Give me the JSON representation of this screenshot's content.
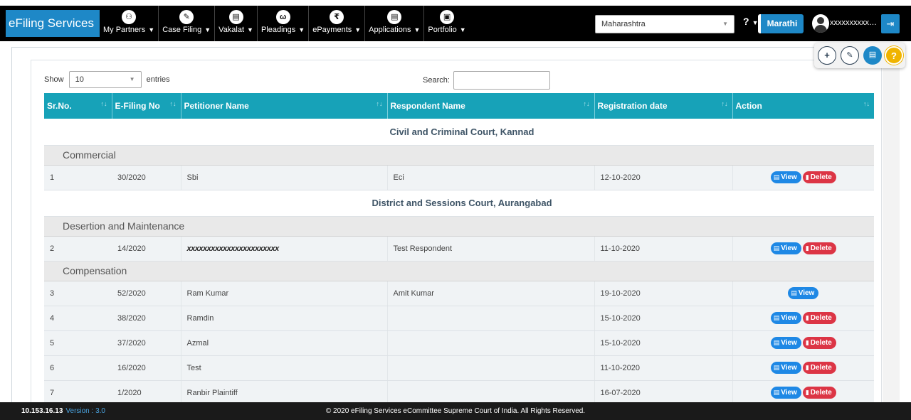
{
  "brand": "eFiling Services",
  "menu": [
    {
      "label": "My Partners",
      "icon": "partners-icon",
      "glyph": "⚇"
    },
    {
      "label": "Case Filing",
      "icon": "pencil-icon",
      "glyph": "✎"
    },
    {
      "label": "Vakalat",
      "icon": "document-icon",
      "glyph": "▤"
    },
    {
      "label": "Pleadings",
      "icon": "handshake-icon",
      "glyph": "ω"
    },
    {
      "label": "ePayments",
      "icon": "rupee-icon",
      "glyph": "₹"
    },
    {
      "label": "Applications",
      "icon": "file-icon",
      "glyph": "▤"
    },
    {
      "label": "Portfolio",
      "icon": "briefcase-icon",
      "glyph": "▣"
    }
  ],
  "header": {
    "state": "Maharashtra",
    "help": "?",
    "language": "Marathi",
    "username": "xxxxxxxxxxxxx..."
  },
  "table_controls": {
    "show_label": "Show",
    "entries_value": "10",
    "entries_label": "entries",
    "search_label": "Search:"
  },
  "columns": [
    "Sr.No.",
    "E-Filing No",
    "Petitioner Name",
    "Respondent Name",
    "Registration date",
    "Action"
  ],
  "groups": [
    {
      "court": "Civil and Criminal Court, Kannad",
      "categories": [
        {
          "name": "Commercial",
          "rows": [
            {
              "sr": "1",
              "efiling": "30/2020",
              "petitioner": "Sbi",
              "respondent": "Eci",
              "date": "12-10-2020",
              "delete": true
            }
          ]
        }
      ]
    },
    {
      "court": "District and Sessions Court, Aurangabad",
      "categories": [
        {
          "name": "Desertion and Maintenance",
          "rows": [
            {
              "sr": "2",
              "efiling": "14/2020",
              "petitioner": "xxxxxxxxxxxxxxxxxxxxxxx",
              "respondent": "Test Respondent",
              "date": "11-10-2020",
              "delete": true,
              "redacted": true
            }
          ]
        },
        {
          "name": "Compensation",
          "rows": [
            {
              "sr": "3",
              "efiling": "52/2020",
              "petitioner": "Ram Kumar",
              "respondent": "Amit Kumar",
              "date": "19-10-2020",
              "delete": false
            },
            {
              "sr": "4",
              "efiling": "38/2020",
              "petitioner": "Ramdin",
              "respondent": "",
              "date": "15-10-2020",
              "delete": true
            },
            {
              "sr": "5",
              "efiling": "37/2020",
              "petitioner": "Azmal",
              "respondent": "",
              "date": "15-10-2020",
              "delete": true
            },
            {
              "sr": "6",
              "efiling": "16/2020",
              "petitioner": "Test",
              "respondent": "",
              "date": "11-10-2020",
              "delete": true
            },
            {
              "sr": "7",
              "efiling": "1/2020",
              "petitioner": "Ranbir Plaintiff",
              "respondent": "",
              "date": "16-07-2020",
              "delete": true
            }
          ]
        }
      ]
    }
  ],
  "actions": {
    "view": "View",
    "delete": "Delete"
  },
  "footer": {
    "ip": "10.153.16.13",
    "version": "Version : 3.0",
    "copyright": "© 2020 eFiling Services eCommittee Supreme Court of India. All Rights Reserved."
  },
  "colors": {
    "brand": "#1e88c7",
    "table_header": "#17a2b8",
    "view": "#1e88e5",
    "delete": "#dc3545"
  }
}
